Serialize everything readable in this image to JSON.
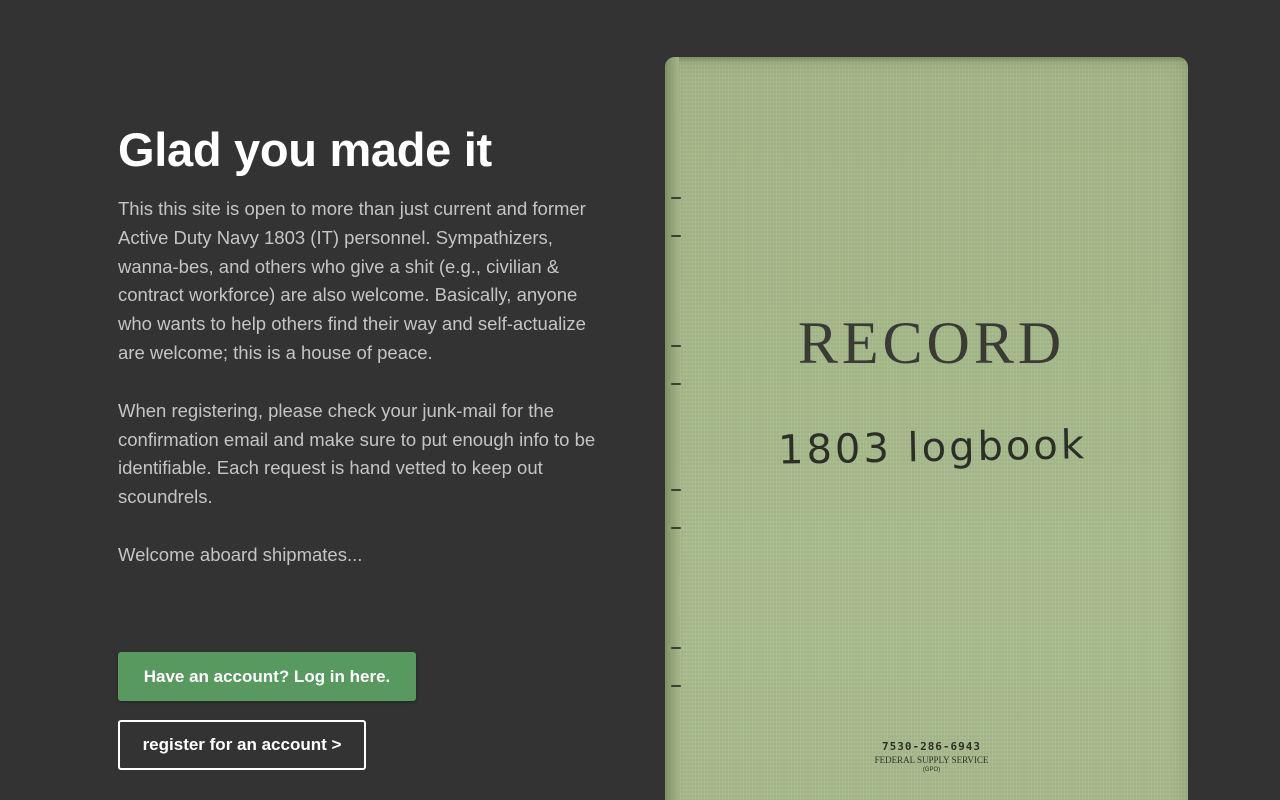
{
  "intro": {
    "heading": "Glad you made it",
    "paragraphs": [
      "This this site is open to more than just current and former Active Duty Navy 1803 (IT) personnel. Sympathizers, wanna-bes, and others who give a shit (e.g., civilian & contract workforce) are also welcome. Basically, anyone who wants to help others find their way and self-actualize are welcome; this is a house of peace.",
      "When registering, please check your junk-mail for the confirmation email and make sure to put enough info to be identifiable. Each request is hand vetted to keep out scoundrels.",
      "Welcome aboard shipmates..."
    ]
  },
  "actions": {
    "login_label": "Have an account? Log in here.",
    "register_label": "register for an account >"
  },
  "logbook": {
    "title": "RECORD",
    "handwritten": "1803 logbook",
    "stock_number": "7530-286-6943",
    "supplier": "FEDERAL SUPPLY SERVICE",
    "publisher": "(GPO)"
  },
  "colors": {
    "background": "#333333",
    "login_button": "#57995f",
    "cover": "#a6ba8a"
  }
}
